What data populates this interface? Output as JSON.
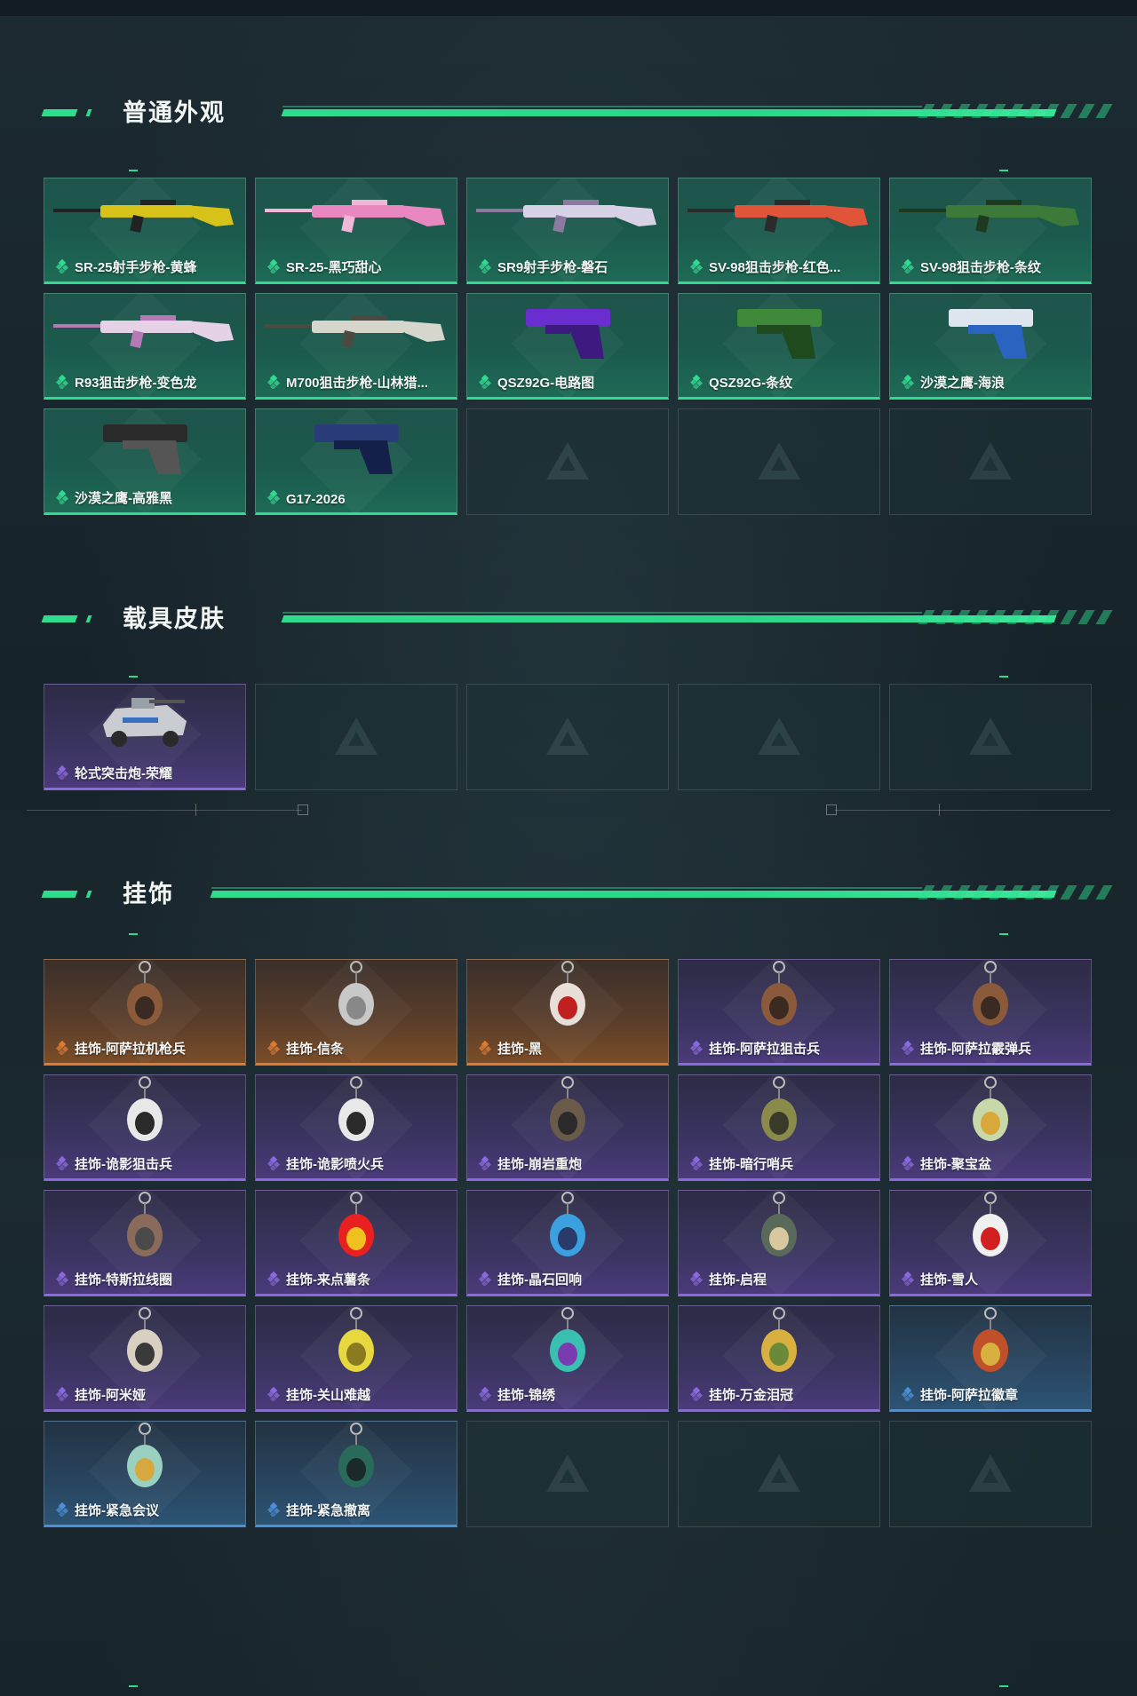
{
  "sections": [
    {
      "title": "普通外观",
      "items": [
        {
          "name": "SR-25射手步枪-黄蜂",
          "rarity": "green",
          "icon": "rifle-yellow-black"
        },
        {
          "name": "SR-25-黑巧甜心",
          "rarity": "green",
          "icon": "rifle-pink"
        },
        {
          "name": "SR9射手步枪-磐石",
          "rarity": "green",
          "icon": "rifle-white-purple"
        },
        {
          "name": "SV-98狙击步枪-红色...",
          "rarity": "green",
          "icon": "sniper-red"
        },
        {
          "name": "SV-98狙击步枪-条纹",
          "rarity": "green",
          "icon": "sniper-green"
        },
        {
          "name": "R93狙击步枪-变色龙",
          "rarity": "green",
          "icon": "sniper-pink-white"
        },
        {
          "name": "M700狙击步枪-山林猎...",
          "rarity": "green",
          "icon": "sniper-white-camo"
        },
        {
          "name": "QSZ92G-电路图",
          "rarity": "green",
          "icon": "pistol-purple"
        },
        {
          "name": "QSZ92G-条纹",
          "rarity": "green",
          "icon": "pistol-green"
        },
        {
          "name": "沙漠之鹰-海浪",
          "rarity": "green",
          "icon": "pistol-blue-wave"
        },
        {
          "name": "沙漠之鹰-高雅黑",
          "rarity": "green",
          "icon": "pistol-black"
        },
        {
          "name": "G17-2026",
          "rarity": "green",
          "icon": "pistol-navy"
        }
      ],
      "empty_slots": 3
    },
    {
      "title": "载具皮肤",
      "items": [
        {
          "name": "轮式突击炮-荣耀",
          "rarity": "purple",
          "icon": "vehicle-armored"
        }
      ],
      "empty_slots": 4
    },
    {
      "title": "挂饰",
      "items": [
        {
          "name": "挂饰-阿萨拉机枪兵",
          "rarity": "orange",
          "icon": "charm-soldier"
        },
        {
          "name": "挂饰-信条",
          "rarity": "orange",
          "icon": "charm-silver"
        },
        {
          "name": "挂饰-黑",
          "rarity": "orange",
          "icon": "charm-tag"
        },
        {
          "name": "挂饰-阿萨拉狙击兵",
          "rarity": "purple",
          "icon": "charm-soldier"
        },
        {
          "name": "挂饰-阿萨拉霰弹兵",
          "rarity": "purple",
          "icon": "charm-soldier"
        },
        {
          "name": "挂饰-诡影狙击兵",
          "rarity": "purple",
          "icon": "charm-mask"
        },
        {
          "name": "挂饰-诡影喷火兵",
          "rarity": "purple",
          "icon": "charm-mask"
        },
        {
          "name": "挂饰-崩岩重炮",
          "rarity": "purple",
          "icon": "charm-heavy"
        },
        {
          "name": "挂饰-暗行哨兵",
          "rarity": "purple",
          "icon": "charm-helmet"
        },
        {
          "name": "挂饰-聚宝盆",
          "rarity": "purple",
          "icon": "charm-bowl"
        },
        {
          "name": "挂饰-特斯拉线圈",
          "rarity": "purple",
          "icon": "charm-coil"
        },
        {
          "name": "挂饰-来点薯条",
          "rarity": "purple",
          "icon": "charm-fries"
        },
        {
          "name": "挂饰-晶石回响",
          "rarity": "purple",
          "icon": "charm-crystal"
        },
        {
          "name": "挂饰-启程",
          "rarity": "purple",
          "icon": "charm-compass"
        },
        {
          "name": "挂饰-雪人",
          "rarity": "purple",
          "icon": "charm-snowman"
        },
        {
          "name": "挂饰-阿米娅",
          "rarity": "purple",
          "icon": "charm-bunny"
        },
        {
          "name": "挂饰-关山难越",
          "rarity": "purple",
          "icon": "charm-scroll"
        },
        {
          "name": "挂饰-锦绣",
          "rarity": "purple",
          "icon": "charm-butterfly"
        },
        {
          "name": "挂饰-万金泪冠",
          "rarity": "purple",
          "icon": "charm-burger"
        },
        {
          "name": "挂饰-阿萨拉徽章",
          "rarity": "blue",
          "icon": "charm-badge"
        },
        {
          "name": "挂饰-紧急会议",
          "rarity": "blue",
          "icon": "charm-figure"
        },
        {
          "name": "挂饰-紧急撤离",
          "rarity": "blue",
          "icon": "charm-box"
        }
      ],
      "empty_slots": 3
    }
  ],
  "colors": {
    "accent": "#2fdc8d",
    "green": "#2fdc8d",
    "purple": "#8a68e0",
    "orange": "#e07a30",
    "blue": "#4a8fd9"
  }
}
